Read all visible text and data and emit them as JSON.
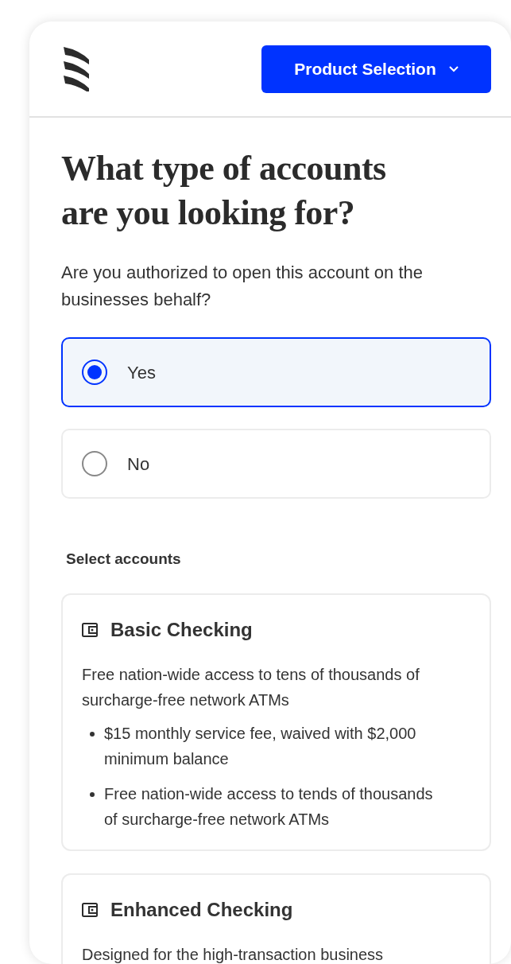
{
  "header": {
    "button": {
      "label": "Product Selection"
    }
  },
  "title": "What type of accounts are you looking for?",
  "question": "Are you authorized to open this account on the businesses behalf?",
  "options": [
    {
      "label": "Yes",
      "selected": true
    },
    {
      "label": "No",
      "selected": false
    }
  ],
  "accounts_label": "Select accounts",
  "accounts": [
    {
      "name": "Basic Checking",
      "description": "Free nation-wide access to tens of thousands of surcharge-free network ATMs",
      "bullets": [
        "$15 monthly service fee, waived with $2,000 minimum balance",
        "Free nation-wide access to tends of thousands of surcharge-free network ATMs"
      ]
    },
    {
      "name": "Enhanced Checking",
      "description": "Designed for the high-transaction business"
    }
  ]
}
